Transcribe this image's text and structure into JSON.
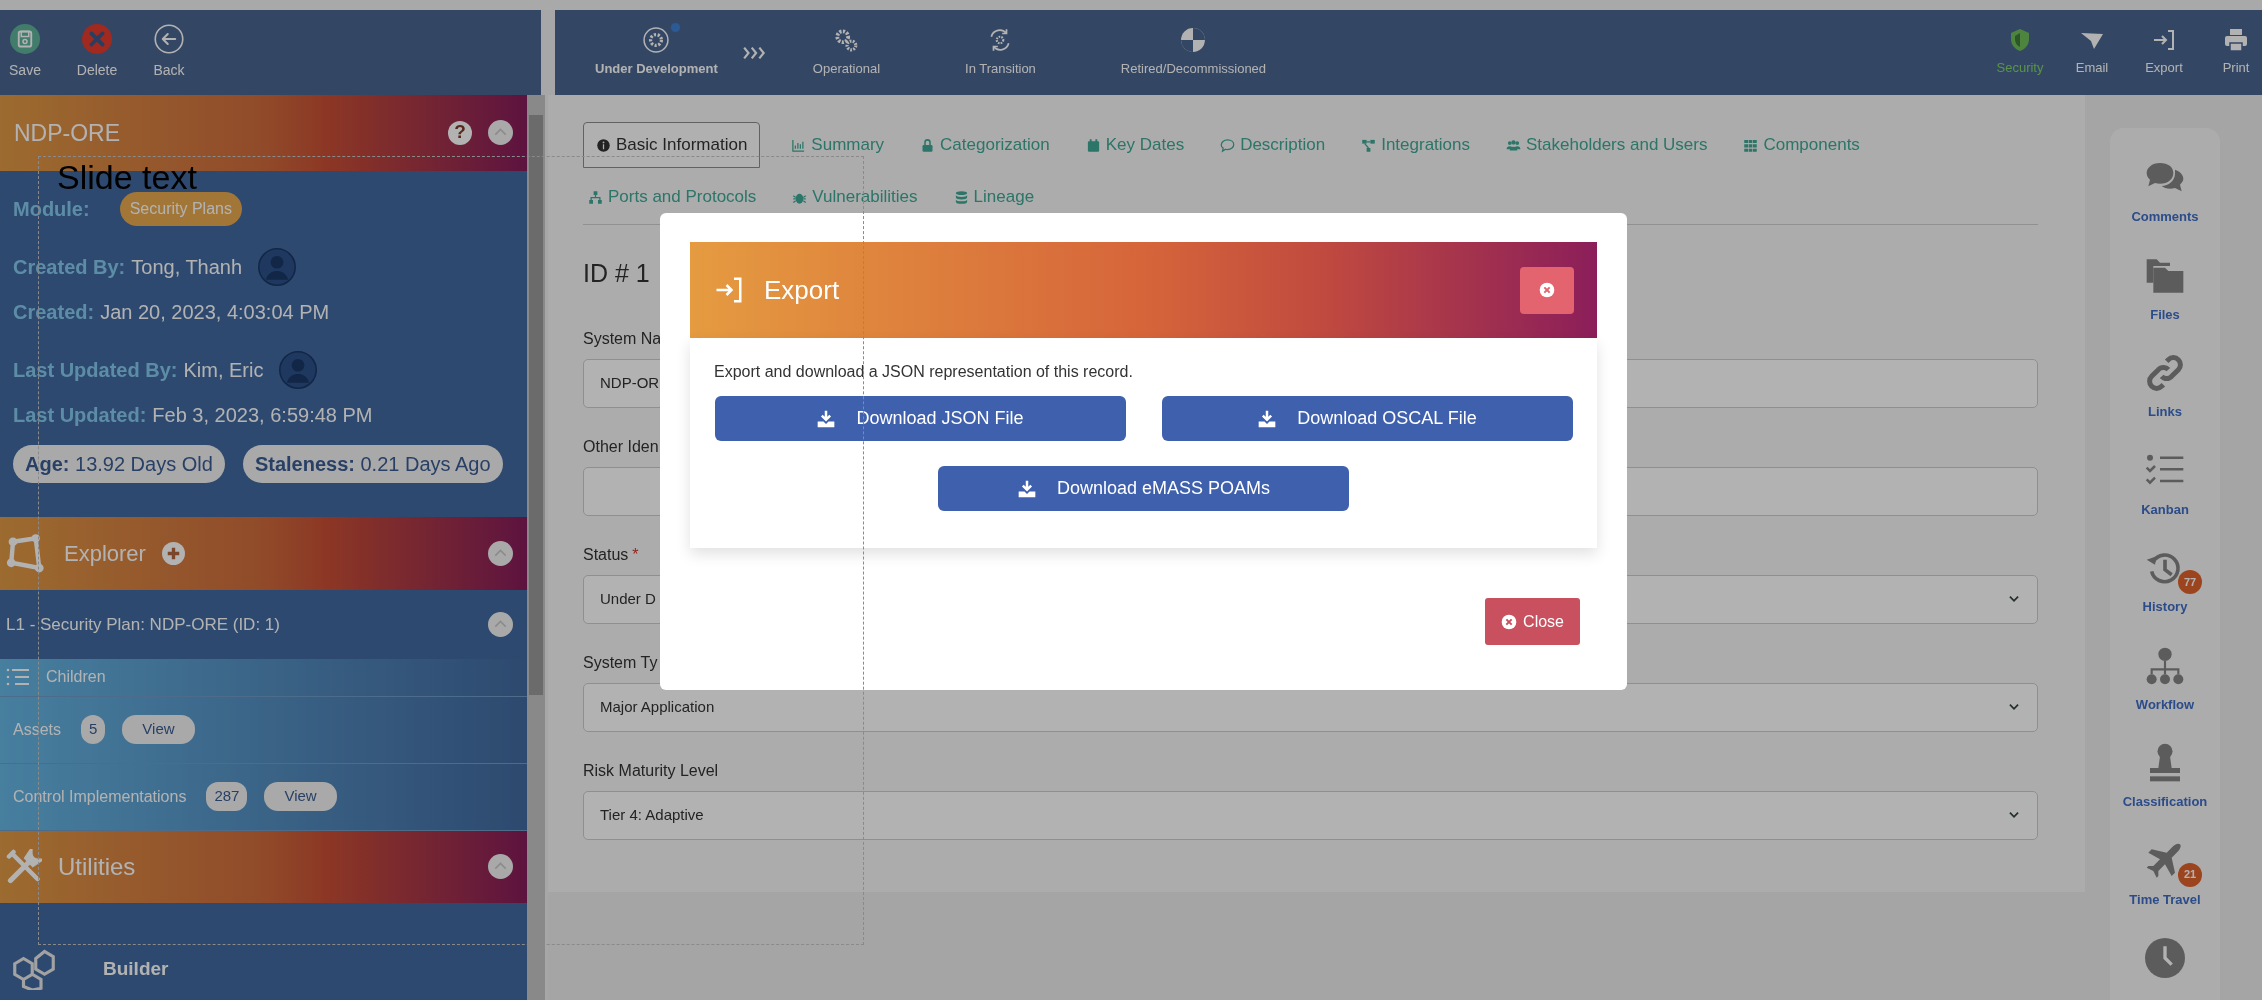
{
  "toolbar": [
    {
      "label": "Save",
      "kind": "save"
    },
    {
      "label": "Delete",
      "kind": "delete"
    },
    {
      "label": "Back",
      "kind": "back"
    }
  ],
  "lifecycle": [
    {
      "label": "Under Development",
      "selected": true
    },
    {
      "label": "Operational",
      "selected": false
    },
    {
      "label": "In Transition",
      "selected": false
    },
    {
      "label": "Retired/Decommissioned",
      "selected": false
    }
  ],
  "actions": [
    {
      "label": "Security",
      "kind": "security"
    },
    {
      "label": "Email",
      "kind": "email"
    },
    {
      "label": "Export",
      "kind": "export"
    },
    {
      "label": "Print",
      "kind": "print"
    }
  ],
  "record": {
    "title": "NDP-ORE",
    "help": "?",
    "module_label": "Module:",
    "module": "Security Plans",
    "fields": [
      {
        "label": "Created By:",
        "value": "Tong, Thanh",
        "kind": "user"
      },
      {
        "label": "Created:",
        "value": "Jan 20, 2023, 4:03:04 PM",
        "kind": "text"
      },
      {
        "label": "Last Updated By:",
        "value": "Kim, Eric",
        "kind": "user"
      },
      {
        "label": "Last Updated:",
        "value": "Feb 3, 2023, 6:59:48 PM",
        "kind": "text"
      }
    ],
    "badges": [
      {
        "label": "Age:",
        "value": "13.92 Days Old"
      },
      {
        "label": "Staleness:",
        "value": "0.21 Days Ago"
      }
    ]
  },
  "explorer": {
    "title": "Explorer",
    "node": "L1 - Security Plan: NDP-ORE (ID: 1)",
    "children_label": "Children",
    "children": [
      {
        "label": "Assets",
        "count": "5",
        "action": "View"
      },
      {
        "label": "Control Implementations",
        "count": "287",
        "action": "View"
      }
    ]
  },
  "utilities": {
    "title": "Utilities",
    "items": [
      {
        "label": "Builder"
      }
    ]
  },
  "tabs": [
    {
      "label": "Basic Information",
      "selected": true
    },
    {
      "label": "Summary",
      "selected": false
    },
    {
      "label": "Categorization",
      "selected": false
    },
    {
      "label": "Key Dates",
      "selected": false
    },
    {
      "label": "Description",
      "selected": false
    },
    {
      "label": "Integrations",
      "selected": false
    },
    {
      "label": "Stakeholders and Users",
      "selected": false
    },
    {
      "label": "Components",
      "selected": false
    },
    {
      "label": "Ports and Protocols",
      "selected": false
    },
    {
      "label": "Vulnerabilities",
      "selected": false
    },
    {
      "label": "Lineage",
      "selected": false
    }
  ],
  "form": {
    "heading": "ID # 1",
    "fields": [
      {
        "label": "System Na",
        "value": "NDP-OR",
        "kind": "text"
      },
      {
        "label": "Other Iden",
        "kind": "text"
      },
      {
        "label": "Status",
        "mark": "*",
        "value": "Under D",
        "kind": "select"
      },
      {
        "label": "System Ty",
        "value": "Major Application",
        "kind": "select"
      },
      {
        "label": "Risk Maturity Level",
        "value": "Tier 4: Adaptive",
        "kind": "select"
      }
    ]
  },
  "side_panel": [
    {
      "label": "Comments"
    },
    {
      "label": "Files"
    },
    {
      "label": "Links"
    },
    {
      "label": "Kanban"
    },
    {
      "label": "History",
      "badge": "77"
    },
    {
      "label": "Workflow"
    },
    {
      "label": "Classification"
    },
    {
      "label": "Time Travel",
      "badge": "21"
    }
  ],
  "modal": {
    "title": "Export",
    "message": "Export and download a JSON representation of this record.",
    "buttons": [
      "Download JSON File",
      "Download OSCAL File",
      "Download eMASS POAMs"
    ],
    "close": "Close"
  },
  "overlay_text": "Slide text"
}
